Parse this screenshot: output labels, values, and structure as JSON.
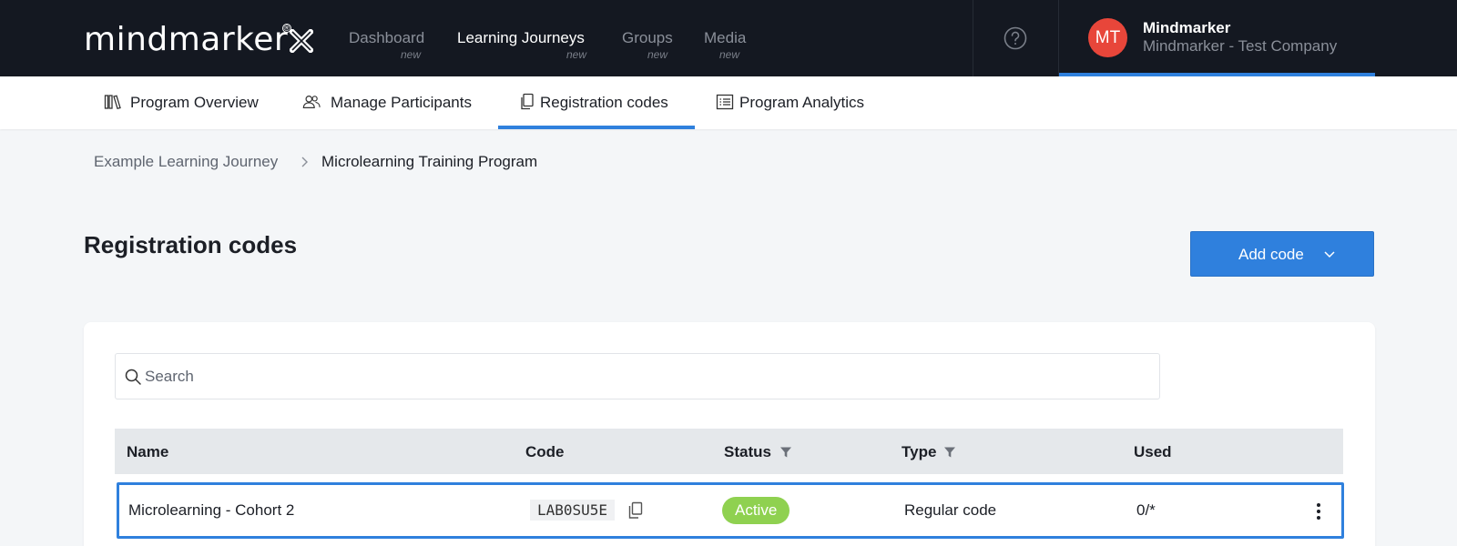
{
  "brand": {
    "logo_text": "mindmarker",
    "logo_mark": "x-mark-icon",
    "registered": "®"
  },
  "nav": [
    {
      "label": "Dashboard",
      "badge": "new",
      "active": false
    },
    {
      "label": "Learning Journeys",
      "badge": "new",
      "active": true
    },
    {
      "label": "Groups",
      "badge": "new",
      "active": false
    },
    {
      "label": "Media",
      "badge": "new",
      "active": false
    }
  ],
  "account": {
    "initials": "MT",
    "name": "Mindmarker",
    "company": "Mindmarker - Test Company",
    "avatar_color": "#e8463a"
  },
  "subnav": [
    {
      "label": "Program Overview",
      "icon": "books-icon",
      "active": false
    },
    {
      "label": "Manage Participants",
      "icon": "users-icon",
      "active": false
    },
    {
      "label": "Registration codes",
      "icon": "copy-icon",
      "active": true
    },
    {
      "label": "Program Analytics",
      "icon": "list-icon",
      "active": false
    }
  ],
  "breadcrumb": [
    "Example Learning Journey",
    "Microlearning Training Program"
  ],
  "page": {
    "title": "Registration codes",
    "add_button": "Add code"
  },
  "search": {
    "placeholder": "Search",
    "value": ""
  },
  "table": {
    "columns": [
      "Name",
      "Code",
      "Status",
      "Type",
      "Used"
    ],
    "rows": [
      {
        "name": "Microlearning - Cohort 2",
        "code": "LAB0SU5E",
        "status": "Active",
        "type": "Regular code",
        "used": "0/*"
      }
    ]
  },
  "colors": {
    "accent": "#2f80dd",
    "topbar": "#141821",
    "active_badge": "#8fd150"
  }
}
